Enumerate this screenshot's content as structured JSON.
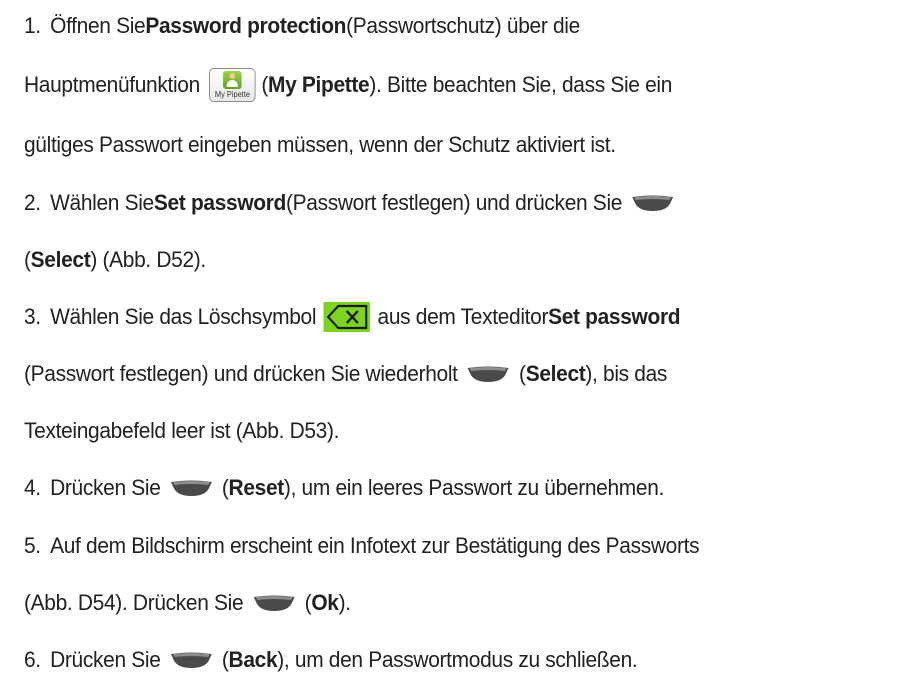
{
  "steps": [
    {
      "num": "1.",
      "lines": [
        {
          "a": "Öffnen Sie ",
          "b": "Password protection",
          "c": " (Passwortschutz) über die"
        },
        {
          "a": "Hauptmenüfunktion",
          "icon_label": "My Pipette",
          "b": "My Pipette",
          "c": "). Bitte beachten Sie, dass Sie ein",
          "pre": " ("
        },
        {
          "a": "gültiges Passwort eingeben müssen, wenn der Schutz aktiviert ist."
        }
      ]
    },
    {
      "num": "2.",
      "lines": [
        {
          "a": "Wählen Sie ",
          "b": "Set password",
          "c": " (Passwort festlegen) und drücken Sie"
        },
        {
          "pre": "(",
          "b": "Select",
          "c": ") (Abb. D52)."
        }
      ]
    },
    {
      "num": "3.",
      "lines": [
        {
          "a": "Wählen Sie das Löschsymbol",
          "b": "Set password",
          "mid": "aus dem Texteditor "
        },
        {
          "a": "(Passwort festlegen) und drücken Sie wiederholt",
          "pre": "(",
          "b": "Select",
          "c": "), bis das"
        },
        {
          "a": "Texteingabefeld leer ist (Abb. D53)."
        }
      ]
    },
    {
      "num": "4.",
      "lines": [
        {
          "a": "Drücken Sie",
          "pre": "(",
          "b": "Reset",
          "c": "), um ein leeres Passwort zu übernehmen."
        }
      ]
    },
    {
      "num": "5.",
      "lines": [
        {
          "a": "Auf dem Bildschirm erscheint ein Infotext zur Bestätigung des Passworts"
        },
        {
          "a": "(Abb. D54). Drücken Sie",
          "pre": "(",
          "b": "Ok",
          "c": ")."
        }
      ]
    },
    {
      "num": "6.",
      "lines": [
        {
          "a": "Drücken Sie",
          "pre": "(",
          "b": "Back",
          "c": "), um den Passwortmodus zu schließen."
        }
      ]
    }
  ],
  "icons": {
    "softkey": "softkey-icon",
    "menu": "my-pipette-icon",
    "delete": "delete-icon",
    "delete_color": "#7ed321",
    "softkey_color": "#4a4a4a"
  }
}
